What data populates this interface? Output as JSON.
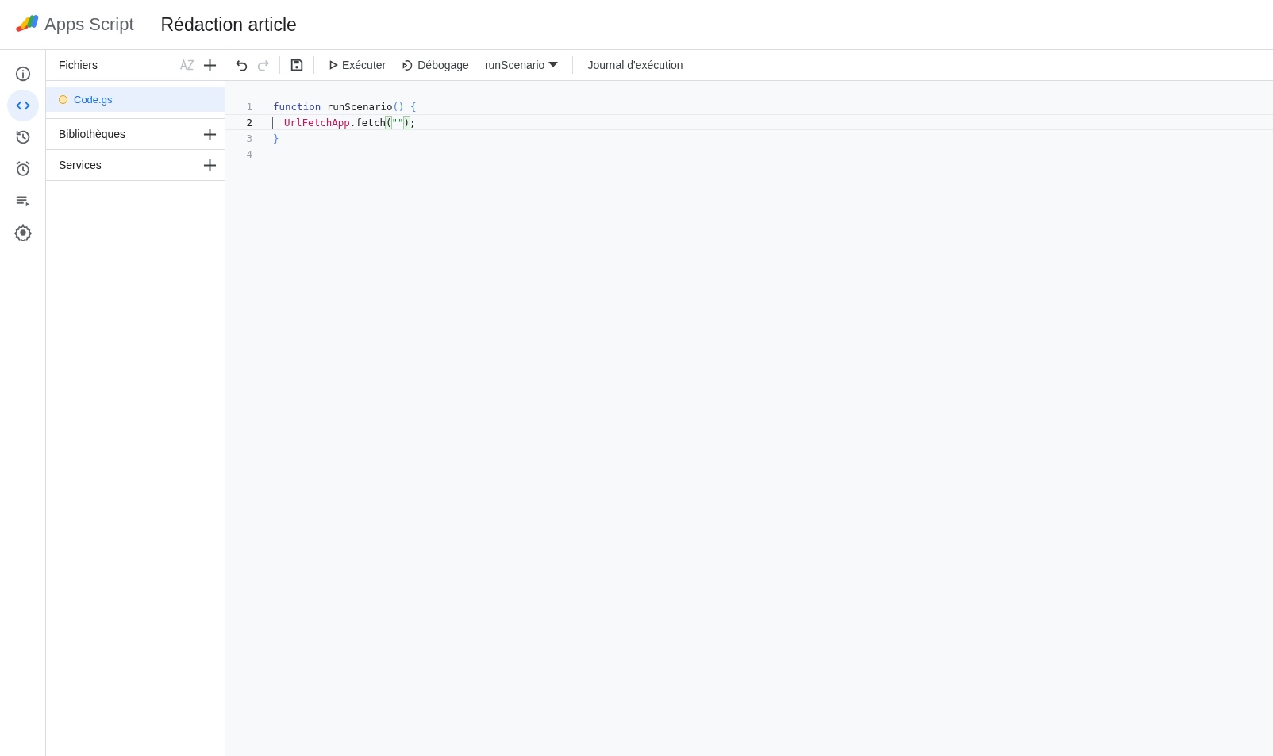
{
  "header": {
    "product": "Apps Script",
    "project_title": "Rédaction article"
  },
  "rail": [
    {
      "selected": false
    },
    {
      "selected": true
    },
    {
      "selected": false
    },
    {
      "selected": false
    },
    {
      "selected": false
    },
    {
      "selected": false
    }
  ],
  "files_panel": {
    "title": "Fichiers",
    "files": [
      {
        "name": "Code.gs",
        "selected": true
      }
    ],
    "sections": [
      {
        "title": "Bibliothèques"
      },
      {
        "title": "Services"
      }
    ]
  },
  "toolbar": [
    {
      "kind": "undo",
      "disabled": false
    },
    {
      "kind": "redo",
      "disabled": true
    },
    {
      "kind": "divider"
    },
    {
      "kind": "save",
      "disabled": false
    },
    {
      "kind": "divider"
    },
    {
      "kind": "run",
      "label": "Exécuter"
    },
    {
      "kind": "debug",
      "label": "Débogage"
    },
    {
      "kind": "select",
      "label": "runScenario"
    },
    {
      "kind": "divider"
    },
    {
      "kind": "text",
      "label": "Journal d'exécution"
    },
    {
      "kind": "divider"
    }
  ],
  "editor": {
    "lines": [
      {
        "number": "1",
        "current": false,
        "tokens": [
          {
            "kind": "keyword",
            "text": "function"
          },
          {
            "kind": "plain",
            "text": " runScenario"
          },
          {
            "kind": "punct",
            "text": "()"
          },
          {
            "kind": "punct",
            "text": " {"
          }
        ]
      },
      {
        "number": "2",
        "current": true,
        "indented": true,
        "tokens": [
          {
            "kind": "class",
            "text": "UrlFetchApp"
          },
          {
            "kind": "plain",
            "text": ".fetch"
          },
          {
            "kind": "match",
            "text": "("
          },
          {
            "kind": "string",
            "text": "\"\""
          },
          {
            "kind": "match",
            "text": ")"
          },
          {
            "kind": "plain",
            "text": ";"
          }
        ]
      },
      {
        "number": "3",
        "current": false,
        "tokens": [
          {
            "kind": "punct",
            "text": "}"
          }
        ]
      },
      {
        "number": "4",
        "current": false
      }
    ]
  }
}
